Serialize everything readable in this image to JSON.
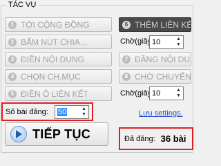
{
  "group_title": "TÁC VỤ",
  "left_buttons": [
    {
      "num": "1",
      "label": "TỚI CỘNG ĐỒNG"
    },
    {
      "num": "2",
      "label": "BẤM NÚT CHIA..."
    },
    {
      "num": "3",
      "label": "ĐIỀN NỘI DUNG"
    },
    {
      "num": "4",
      "label": "CHỌN CH.MỤC"
    },
    {
      "num": "5",
      "label": "ĐIỀN Ô LIÊN KẾT"
    }
  ],
  "right_buttons": [
    {
      "num": "6",
      "label": "THÊM LIÊN KẾT"
    },
    {
      "num": "7",
      "label": "ĐĂNG NỘI DUNG"
    },
    {
      "num": "8",
      "label": "CHỜ CHUYỂN"
    }
  ],
  "wait1": {
    "label": "Chờ(giây):",
    "value": "10"
  },
  "wait2": {
    "label": "Chờ(giây):",
    "value": "10"
  },
  "post_count": {
    "label": "Số bài đăng:",
    "value": "50"
  },
  "save_link": "Lưu settings.",
  "go_button": "TIẾP TỤC",
  "posted": {
    "label": "Đã đăng:",
    "value": "36 bài"
  },
  "colors": {
    "accent_red": "#e02020",
    "link_blue": "#1a4fd8",
    "dark_button": "#4a4a4a"
  }
}
